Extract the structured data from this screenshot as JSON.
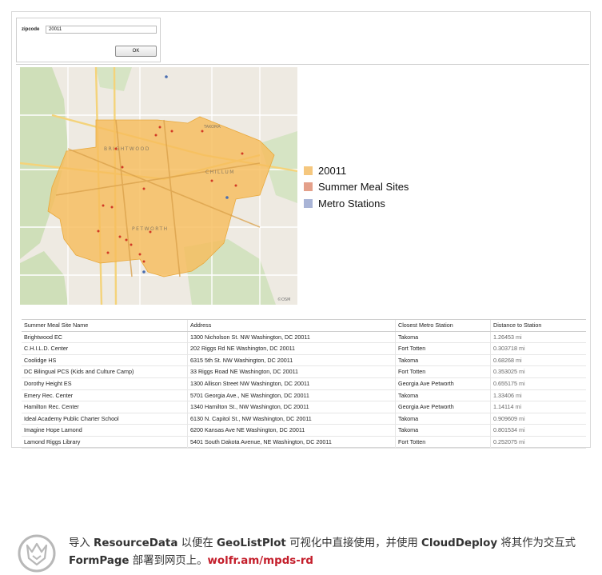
{
  "form": {
    "label": "zipcode",
    "value": "20011",
    "ok_label": "OK"
  },
  "map": {
    "labels": {
      "brightwood": "BRIGHTWOOD",
      "petworth": "PETWORTH",
      "chillum": "CHILLUM",
      "takoma": "TAKOMA",
      "watermark": "©OSM"
    }
  },
  "legend": [
    {
      "label": "20011",
      "color": "#f5c77e"
    },
    {
      "label": "Summer Meal Sites",
      "color": "#e4a08a"
    },
    {
      "label": "Metro Stations",
      "color": "#a9b4d6"
    }
  ],
  "table": {
    "headers": [
      "Summer Meal Site Name",
      "Address",
      "Closest Metro Station",
      "Distance to Station"
    ],
    "unit": "mi",
    "rows": [
      {
        "name": "Brightwood EC",
        "address": "1300 Nicholson St. NW Washington, DC 20011",
        "station": "Takoma",
        "distance": "1.26453"
      },
      {
        "name": "C.H.I.L.D. Center",
        "address": "202 Riggs Rd NE Washington, DC 20011",
        "station": "Fort Totten",
        "distance": "0.303718"
      },
      {
        "name": "Coolidge HS",
        "address": "6315 5th St. NW Washington, DC 20011",
        "station": "Takoma",
        "distance": "0.68268"
      },
      {
        "name": "DC Bilingual PCS (Kids and Culture Camp)",
        "address": "33 Riggs Road NE Washington, DC 20011",
        "station": "Fort Totten",
        "distance": "0.353025"
      },
      {
        "name": "Dorothy Height ES",
        "address": "1300 Allison Street NW Washington, DC 20011",
        "station": "Georgia Ave Petworth",
        "distance": "0.655175"
      },
      {
        "name": "Emery Rec. Center",
        "address": "5701 Georgia Ave., NE Washington, DC 20011",
        "station": "Takoma",
        "distance": "1.33406"
      },
      {
        "name": "Hamilton Rec. Center",
        "address": "1340 Hamilton St., NW Washington, DC 20011",
        "station": "Georgia Ave Petworth",
        "distance": "1.14114"
      },
      {
        "name": "Ideal Academy Public Charter School",
        "address": "6130 N. Capitol St., NW Washington, DC 20011",
        "station": "Takoma",
        "distance": "0.909609"
      },
      {
        "name": "Imagine Hope Lamond",
        "address": "6200 Kansas Ave NE Washington, DC 20011",
        "station": "Takoma",
        "distance": "0.801534"
      },
      {
        "name": "Lamond Riggs Library",
        "address": "5401 South Dakota Avenue, NE Washington, DC 20011",
        "station": "Fort Totten",
        "distance": "0.252075"
      }
    ]
  },
  "footer": {
    "pre1": "导入 ",
    "b1": "ResourceData",
    "mid1": " 以便在 ",
    "b2": "GeoListPlot",
    "mid2": " 可视化中直接使用，并使用 ",
    "b3": "CloudDeploy",
    "mid3": " 将其作为交互式 ",
    "b4": "FormPage",
    "mid4": " 部署到网页上。",
    "link": "wolfr.am/mpds-rd"
  }
}
